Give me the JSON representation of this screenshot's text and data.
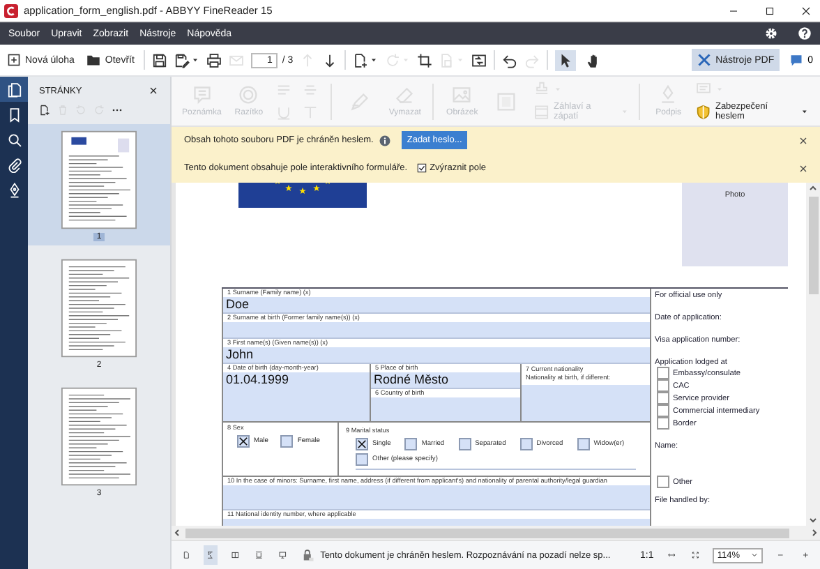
{
  "window": {
    "title": "application_form_english.pdf - ABBYY FineReader 15"
  },
  "menu": [
    {
      "label": "Soubor"
    },
    {
      "label": "Upravit"
    },
    {
      "label": "Zobrazit"
    },
    {
      "label": "Nástroje"
    },
    {
      "label": "Nápověda"
    }
  ],
  "toolbar": {
    "new_task": "Nová úloha",
    "open": "Otevřít",
    "page_field": "1",
    "page_total": "/ 3",
    "actions": [
      {
        "kind": "separator"
      },
      {
        "kind": "save",
        "disabled": false
      },
      {
        "kind": "save_as",
        "disabled": false
      },
      {
        "kind": "print",
        "disabled": false
      },
      {
        "kind": "mail",
        "disabled": true
      },
      {
        "kind": "pager"
      },
      {
        "kind": "up",
        "disabled": true
      },
      {
        "kind": "down",
        "disabled": false
      },
      {
        "kind": "separator"
      },
      {
        "kind": "add_page",
        "disabled": false
      },
      {
        "kind": "rotate",
        "disabled": true
      },
      {
        "kind": "crop",
        "disabled": false
      },
      {
        "kind": "doc_check",
        "disabled": true
      },
      {
        "kind": "compare",
        "disabled": false
      },
      {
        "kind": "separator"
      },
      {
        "kind": "undo",
        "disabled": false
      },
      {
        "kind": "redo",
        "disabled": true
      },
      {
        "kind": "separator"
      }
    ],
    "tools": [
      {
        "kind": "pointer",
        "selected": true
      },
      {
        "kind": "hand",
        "selected": false
      }
    ],
    "pdf_tools": {
      "label": "Nástroje PDF",
      "selected": true
    },
    "comments": "0"
  },
  "side_tabs": [
    {
      "kind": "pages",
      "selected": true
    },
    {
      "kind": "bookmarks",
      "selected": false
    },
    {
      "kind": "search",
      "selected": false
    },
    {
      "kind": "attachments",
      "selected": false
    },
    {
      "kind": "signatures",
      "selected": false
    }
  ],
  "pages_panel": {
    "title": "STRÁNKY",
    "thumbnails": [
      {
        "label": "1",
        "selected": true
      },
      {
        "label": "2",
        "selected": false
      },
      {
        "label": "3",
        "selected": false
      }
    ]
  },
  "ribbon": [
    {
      "kind": "note",
      "label": "Poznámka",
      "disabled": true
    },
    {
      "kind": "stamp",
      "label": "Razítko",
      "disabled": true
    },
    {
      "kind": "text_format",
      "disabled": true
    },
    {
      "kind": "separator"
    },
    {
      "kind": "draw",
      "disabled": true
    },
    {
      "kind": "erase",
      "label": "Vymazat",
      "disabled": true
    },
    {
      "kind": "separator"
    },
    {
      "kind": "image",
      "label": "Obrázek",
      "disabled": true
    },
    {
      "kind": "background",
      "disabled": true
    },
    {
      "kind": "stack",
      "items": [
        {
          "kind": "watermark",
          "disabled": true
        },
        {
          "kind": "header_footer",
          "label": "Záhlaví a zápatí",
          "disabled": true
        }
      ]
    },
    {
      "kind": "separator"
    },
    {
      "kind": "signature",
      "label": "Podpis",
      "disabled": true
    },
    {
      "kind": "stack",
      "items": [
        {
          "kind": "recognize",
          "disabled": true
        },
        {
          "kind": "password",
          "label": "Zabezpečení heslem",
          "disabled": false
        }
      ]
    }
  ],
  "notifications": [
    {
      "kind": "password",
      "text": "Obsah tohoto souboru PDF je chráněn heslem.",
      "button": "Zadat heslo..."
    },
    {
      "kind": "form",
      "text": "Tento dokument obsahuje pole interaktivního formuláře.",
      "checkbox": {
        "label": "Zvýraznit pole",
        "checked": true
      }
    }
  ],
  "document": {
    "photo_label": "Photo",
    "form": {
      "surname": {
        "label": "1  Surname (Family name) (x)",
        "value": "Doe"
      },
      "surname_at_birth": {
        "label": "2  Surname at birth (Former family name(s)) (x)"
      },
      "first_name": {
        "label": "3  First name(s) (Given name(s)) (x)",
        "value": "John"
      },
      "date_of_birth": {
        "label": "4  Date of birth (day-month-year)",
        "value": "01.04.1999"
      },
      "place_of_birth": {
        "label": "5  Place of birth",
        "value": "Rodné Město"
      },
      "country_of_birth": {
        "label": "6  Country of birth"
      },
      "nationality": {
        "label": "7  Current nationality",
        "sublabel": "Nationality at birth, if different:"
      },
      "sex": {
        "label": "8  Sex",
        "options": [
          {
            "label": "Male",
            "checked": true
          },
          {
            "label": "Female",
            "checked": false
          }
        ]
      },
      "marital_status": {
        "label": "9  Marital status",
        "options": [
          {
            "label": "Single",
            "checked": true
          },
          {
            "label": "Married",
            "checked": false
          },
          {
            "label": "Separated",
            "checked": false
          },
          {
            "label": "Divorced",
            "checked": false
          },
          {
            "label": "Widow(er)",
            "checked": false
          }
        ],
        "other": {
          "label": "Other (please specify)",
          "checked": false
        }
      },
      "guardian": {
        "label": "10  In the case of minors: Surname, first name, address (if different from applicant's) and nationality of parental authority/legal guardian"
      },
      "national_id": {
        "label": "11  National identity number, where applicable"
      }
    },
    "official": [
      {
        "kind": "heading",
        "text": "For official use only"
      },
      {
        "kind": "label",
        "text": "Date of application:"
      },
      {
        "kind": "label",
        "text": "Visa application number:"
      },
      {
        "kind": "label",
        "text": "Application lodged at"
      },
      {
        "kind": "checkbox",
        "text": "Embassy/consulate",
        "checked": false
      },
      {
        "kind": "checkbox",
        "text": "CAC",
        "checked": false
      },
      {
        "kind": "checkbox",
        "text": "Service provider",
        "checked": false
      },
      {
        "kind": "checkbox",
        "text": "Commercial intermediary",
        "checked": false
      },
      {
        "kind": "checkbox",
        "text": "Border",
        "checked": false
      },
      {
        "kind": "label",
        "text": "Name:"
      },
      {
        "kind": "checkbox",
        "text": "Other",
        "checked": false
      },
      {
        "kind": "label",
        "text": "File handled by:"
      }
    ]
  },
  "status_bar": {
    "view_modes": [
      {
        "kind": "single_page",
        "selected": false
      },
      {
        "kind": "fit",
        "selected": true
      },
      {
        "kind": "two_pages",
        "selected": false
      },
      {
        "kind": "continuous",
        "selected": false
      },
      {
        "kind": "presentation",
        "selected": false
      }
    ],
    "message": "Tento dokument je chráněn heslem. Rozpoznávání na pozadí nelze sp...",
    "actual_size": "1:1",
    "zoom": "114%"
  }
}
